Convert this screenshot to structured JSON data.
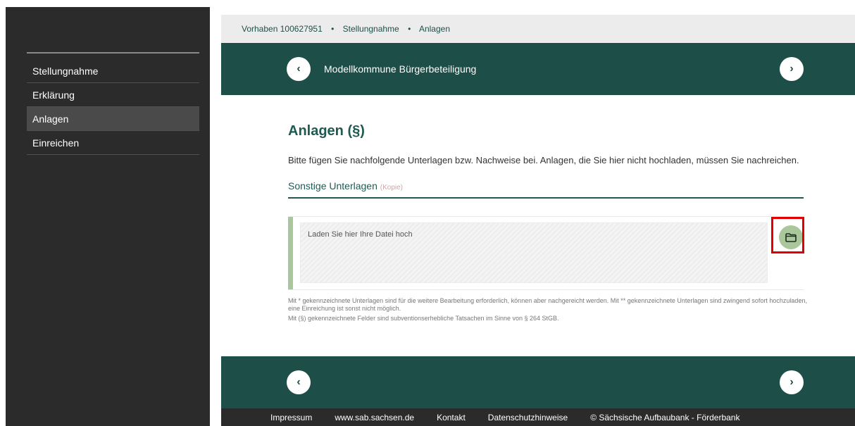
{
  "sidebar": {
    "items": [
      {
        "label": "Stellungnahme"
      },
      {
        "label": "Erklärung"
      },
      {
        "label": "Anlagen"
      },
      {
        "label": "Einreichen"
      }
    ]
  },
  "breadcrumb": {
    "items": [
      "Vorhaben 100627951",
      "Stellungnahme",
      "Anlagen"
    ],
    "separator": "•"
  },
  "banner": {
    "title": "Modellkommune Bürgerbeteiligung",
    "prev_icon": "‹",
    "next_icon": "›"
  },
  "page": {
    "title": "Anlagen (§)",
    "intro": "Bitte fügen Sie nachfolgende Unterlagen bzw. Nachweise bei. Anlagen, die Sie hier nicht hochladen, müssen Sie nachreichen.",
    "section_title": "Sonstige Unterlagen",
    "section_sub": "(Kopie)",
    "upload_placeholder": "Laden Sie hier Ihre Datei hoch",
    "note1": "Mit * gekennzeichnete Unterlagen sind für die weitere Bearbeitung erforderlich, können aber nachgereicht werden. Mit ** gekennzeichnete Unterlagen sind zwingend sofort hochzuladen, eine Einreichung ist sonst nicht möglich.",
    "note2": "Mit (§) gekennzeichnete Felder sind subventionserhebliche Tatsachen im Sinne von § 264 StGB."
  },
  "footer": {
    "links": [
      "Impressum",
      "www.sab.sachsen.de",
      "Kontakt",
      "Datenschutzhinweise",
      "© Sächsische Aufbaubank - Förderbank"
    ]
  },
  "colors": {
    "brand_green": "#1d4e48",
    "accent_light_green": "#a9c79a",
    "highlight_red": "#e00000"
  },
  "icons": {
    "upload": "folder-icon",
    "prev": "chevron-left-icon",
    "next": "chevron-right-icon"
  }
}
